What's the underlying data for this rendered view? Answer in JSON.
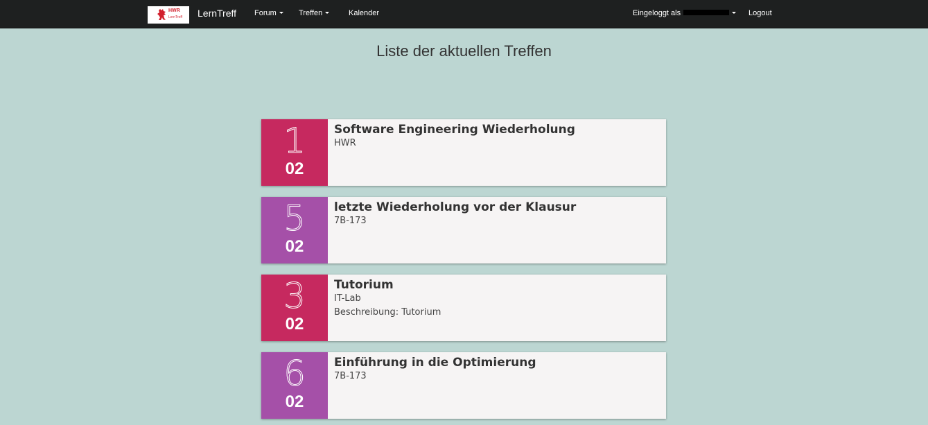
{
  "navbar": {
    "logo": {
      "line1": "HWR",
      "line2": "LernTreff"
    },
    "brand": "LernTreff",
    "menu": [
      {
        "label": "Forum",
        "dropdown": true
      },
      {
        "label": "Treffen",
        "dropdown": true
      },
      {
        "label": "Kalender",
        "dropdown": false
      }
    ],
    "user_label": "Eingeloggt als",
    "logout": "Logout"
  },
  "page": {
    "title": "Liste der aktuellen Treffen"
  },
  "colors": {
    "pink": "#c6295f",
    "purple": "#a550a8",
    "background": "#bcd6d2",
    "navbar": "#1e2020"
  },
  "meetings": [
    {
      "day": "1",
      "month": "02",
      "color": "#c6295f",
      "title": "Software Engineering Wiederholung",
      "location": "HWR",
      "description": ""
    },
    {
      "day": "5",
      "month": "02",
      "color": "#a550a8",
      "title": "letzte Wiederholung vor der Klausur",
      "location": "7B-173",
      "description": ""
    },
    {
      "day": "3",
      "month": "02",
      "color": "#c6295f",
      "title": "Tutorium",
      "location": "IT-Lab",
      "description": "Beschreibung: Tutorium"
    },
    {
      "day": "6",
      "month": "02",
      "color": "#a550a8",
      "title": "Einführung in die Optimierung",
      "location": "7B-173",
      "description": ""
    }
  ]
}
